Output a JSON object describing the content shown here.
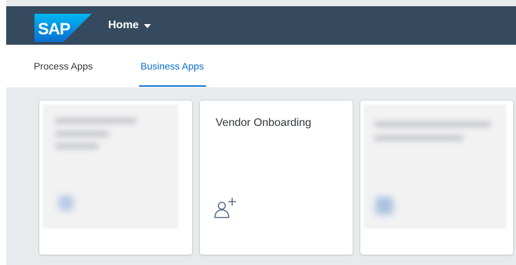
{
  "shell": {
    "logo_text": "SAP",
    "home_label": "Home",
    "colors": {
      "header_bg": "#354a5f",
      "logo_blue": "#0a6ed1"
    }
  },
  "tabs": [
    {
      "label": "Process Apps",
      "selected": false
    },
    {
      "label": "Business Apps",
      "selected": true
    }
  ],
  "tiles": [
    {
      "title": "Vendor Onboarding",
      "icon": "add-person-icon"
    }
  ]
}
